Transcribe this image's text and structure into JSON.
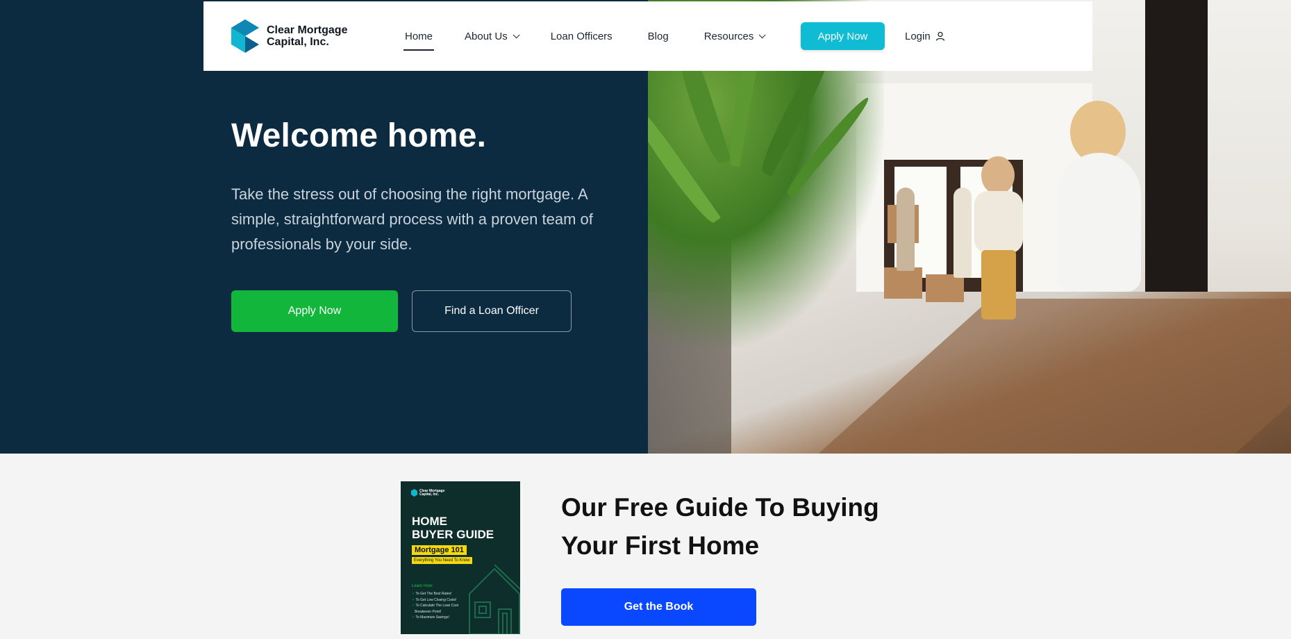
{
  "brand": {
    "name_line1": "Clear Mortgage",
    "name_line2": "Capital, Inc.",
    "accent_color": "#0fbcd4"
  },
  "nav": {
    "items": [
      {
        "label": "Home",
        "active": true,
        "has_dropdown": false
      },
      {
        "label": "About Us",
        "active": false,
        "has_dropdown": true
      },
      {
        "label": "Loan Officers",
        "active": false,
        "has_dropdown": false
      },
      {
        "label": "Blog",
        "active": false,
        "has_dropdown": false
      },
      {
        "label": "Resources",
        "active": false,
        "has_dropdown": true
      }
    ],
    "apply_label": "Apply Now",
    "login_label": "Login"
  },
  "hero": {
    "title": "Welcome home.",
    "subtitle": "Take the stress out of choosing the right mortgage. A simple, straightforward process with a proven team of professionals by your side.",
    "primary_button": "Apply Now",
    "secondary_button": "Find a Loan Officer",
    "background_color": "#0c2b40",
    "primary_color": "#12b63a"
  },
  "guide": {
    "title": "Our Free Guide To Buying Your First Home",
    "button_label": "Get the Book",
    "button_color": "#0a48ff",
    "book": {
      "logo_line1": "Clear Mortgage",
      "logo_line2": "Capital, Inc.",
      "title_line1": "HOME",
      "title_line2": "BUYER GUIDE",
      "tag": "Mortgage 101",
      "tag_sub": "Everything You Need To Know",
      "learn_heading": "Learn How:",
      "learn_items": [
        "To Get The Best Rates!",
        "To Get Low Closing Costs!",
        "To Calculate The Loan Cost",
        "Breakeven Point!",
        "To Maximize Savings!"
      ]
    }
  }
}
